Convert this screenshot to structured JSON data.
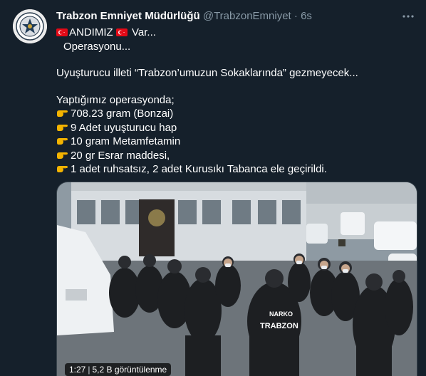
{
  "tweet": {
    "author_name": "Trabzon Emniyet Müdürlüğü",
    "handle": "@TrabzonEmniyet",
    "separator": "·",
    "time": "6s",
    "lines": {
      "l1": "ANDIMIZ",
      "l1b": " Var...",
      "l2": "Operasyonu...",
      "l3": "Uyuşturucu illeti “Trabzon’umuzun Sokaklarında” gezmeyecek...",
      "l4": "Yaptığımız operasyonda;",
      "b1": "708.23 gram  (Bonzai)",
      "b2": "9 Adet uyuşturucu hap",
      "b3": "10 gram Metamfetamin",
      "b4": "20 gr Esrar maddesi,",
      "b5": "1 adet ruhsatsız, 2 adet Kurusıkı Tabanca ele geçirildi."
    }
  },
  "video": {
    "duration": "1:27",
    "separator": "|",
    "views": "5,2 B görüntülenme",
    "vest_text_1": "NARKO",
    "vest_text_2": "TRABZON"
  },
  "icons": {
    "more": "more-horizontal-icon",
    "flag": "turkish-flag-icon",
    "pointer": "pointing-hand-icon"
  },
  "colors": {
    "background": "#15202b",
    "secondary_text": "#8899a6",
    "flag_red": "#e30a17",
    "hand_yellow": "#f4b400"
  }
}
